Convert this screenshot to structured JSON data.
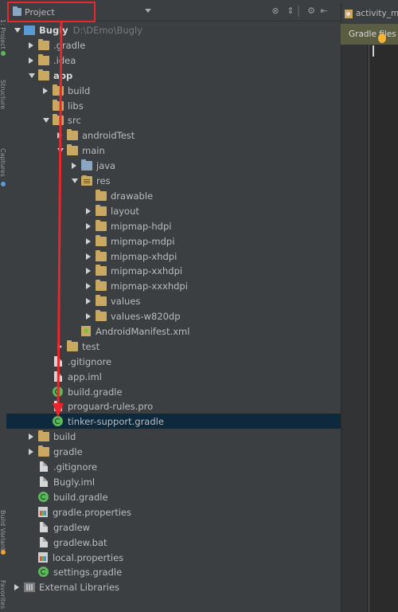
{
  "header": {
    "view_selector": "Project"
  },
  "editor": {
    "tab_label": "activity_m",
    "gradle_banner": "Gradle files"
  },
  "tree": [
    {
      "label": "Bugly",
      "path": "D:\\DEmo\\Bugly",
      "depth": 0,
      "arrow": "down",
      "icon": "module",
      "bold": true
    },
    {
      "label": ".gradle",
      "depth": 1,
      "arrow": "right",
      "icon": "folder"
    },
    {
      "label": ".idea",
      "depth": 1,
      "arrow": "right",
      "icon": "folder"
    },
    {
      "label": "app",
      "depth": 1,
      "arrow": "down",
      "icon": "folder",
      "bold": true
    },
    {
      "label": "build",
      "depth": 2,
      "arrow": "right",
      "icon": "folder"
    },
    {
      "label": "libs",
      "depth": 2,
      "arrow": "none",
      "icon": "folder"
    },
    {
      "label": "src",
      "depth": 2,
      "arrow": "down",
      "icon": "folder"
    },
    {
      "label": "androidTest",
      "depth": 3,
      "arrow": "right",
      "icon": "folder"
    },
    {
      "label": "main",
      "depth": 3,
      "arrow": "down",
      "icon": "folder"
    },
    {
      "label": "java",
      "depth": 4,
      "arrow": "right",
      "icon": "folder-src"
    },
    {
      "label": "res",
      "depth": 4,
      "arrow": "down",
      "icon": "folder-res"
    },
    {
      "label": "drawable",
      "depth": 5,
      "arrow": "none",
      "icon": "folder"
    },
    {
      "label": "layout",
      "depth": 5,
      "arrow": "right",
      "icon": "folder"
    },
    {
      "label": "mipmap-hdpi",
      "depth": 5,
      "arrow": "right",
      "icon": "folder"
    },
    {
      "label": "mipmap-mdpi",
      "depth": 5,
      "arrow": "right",
      "icon": "folder"
    },
    {
      "label": "mipmap-xhdpi",
      "depth": 5,
      "arrow": "right",
      "icon": "folder"
    },
    {
      "label": "mipmap-xxhdpi",
      "depth": 5,
      "arrow": "right",
      "icon": "folder"
    },
    {
      "label": "mipmap-xxxhdpi",
      "depth": 5,
      "arrow": "right",
      "icon": "folder"
    },
    {
      "label": "values",
      "depth": 5,
      "arrow": "right",
      "icon": "folder"
    },
    {
      "label": "values-w820dp",
      "depth": 5,
      "arrow": "right",
      "icon": "folder"
    },
    {
      "label": "AndroidManifest.xml",
      "depth": 4,
      "arrow": "none",
      "icon": "manifest"
    },
    {
      "label": "test",
      "depth": 3,
      "arrow": "right",
      "icon": "folder"
    },
    {
      "label": ".gitignore",
      "depth": 2,
      "arrow": "none",
      "icon": "file"
    },
    {
      "label": "app.iml",
      "depth": 2,
      "arrow": "none",
      "icon": "file"
    },
    {
      "label": "build.gradle",
      "depth": 2,
      "arrow": "none",
      "icon": "gradle"
    },
    {
      "label": "proguard-rules.pro",
      "depth": 2,
      "arrow": "none",
      "icon": "file"
    },
    {
      "label": "tinker-support.gradle",
      "depth": 2,
      "arrow": "none",
      "icon": "gradle",
      "selected": true
    },
    {
      "label": "build",
      "depth": 1,
      "arrow": "right",
      "icon": "folder"
    },
    {
      "label": "gradle",
      "depth": 1,
      "arrow": "right",
      "icon": "folder"
    },
    {
      "label": ".gitignore",
      "depth": 1,
      "arrow": "none",
      "icon": "file"
    },
    {
      "label": "Bugly.iml",
      "depth": 1,
      "arrow": "none",
      "icon": "file"
    },
    {
      "label": "build.gradle",
      "depth": 1,
      "arrow": "none",
      "icon": "gradle"
    },
    {
      "label": "gradle.properties",
      "depth": 1,
      "arrow": "none",
      "icon": "props"
    },
    {
      "label": "gradlew",
      "depth": 1,
      "arrow": "none",
      "icon": "file"
    },
    {
      "label": "gradlew.bat",
      "depth": 1,
      "arrow": "none",
      "icon": "file"
    },
    {
      "label": "local.properties",
      "depth": 1,
      "arrow": "none",
      "icon": "props"
    },
    {
      "label": "settings.gradle",
      "depth": 1,
      "arrow": "none",
      "icon": "gradle"
    },
    {
      "label": "External Libraries",
      "depth": 0,
      "arrow": "right",
      "icon": "libs"
    }
  ]
}
